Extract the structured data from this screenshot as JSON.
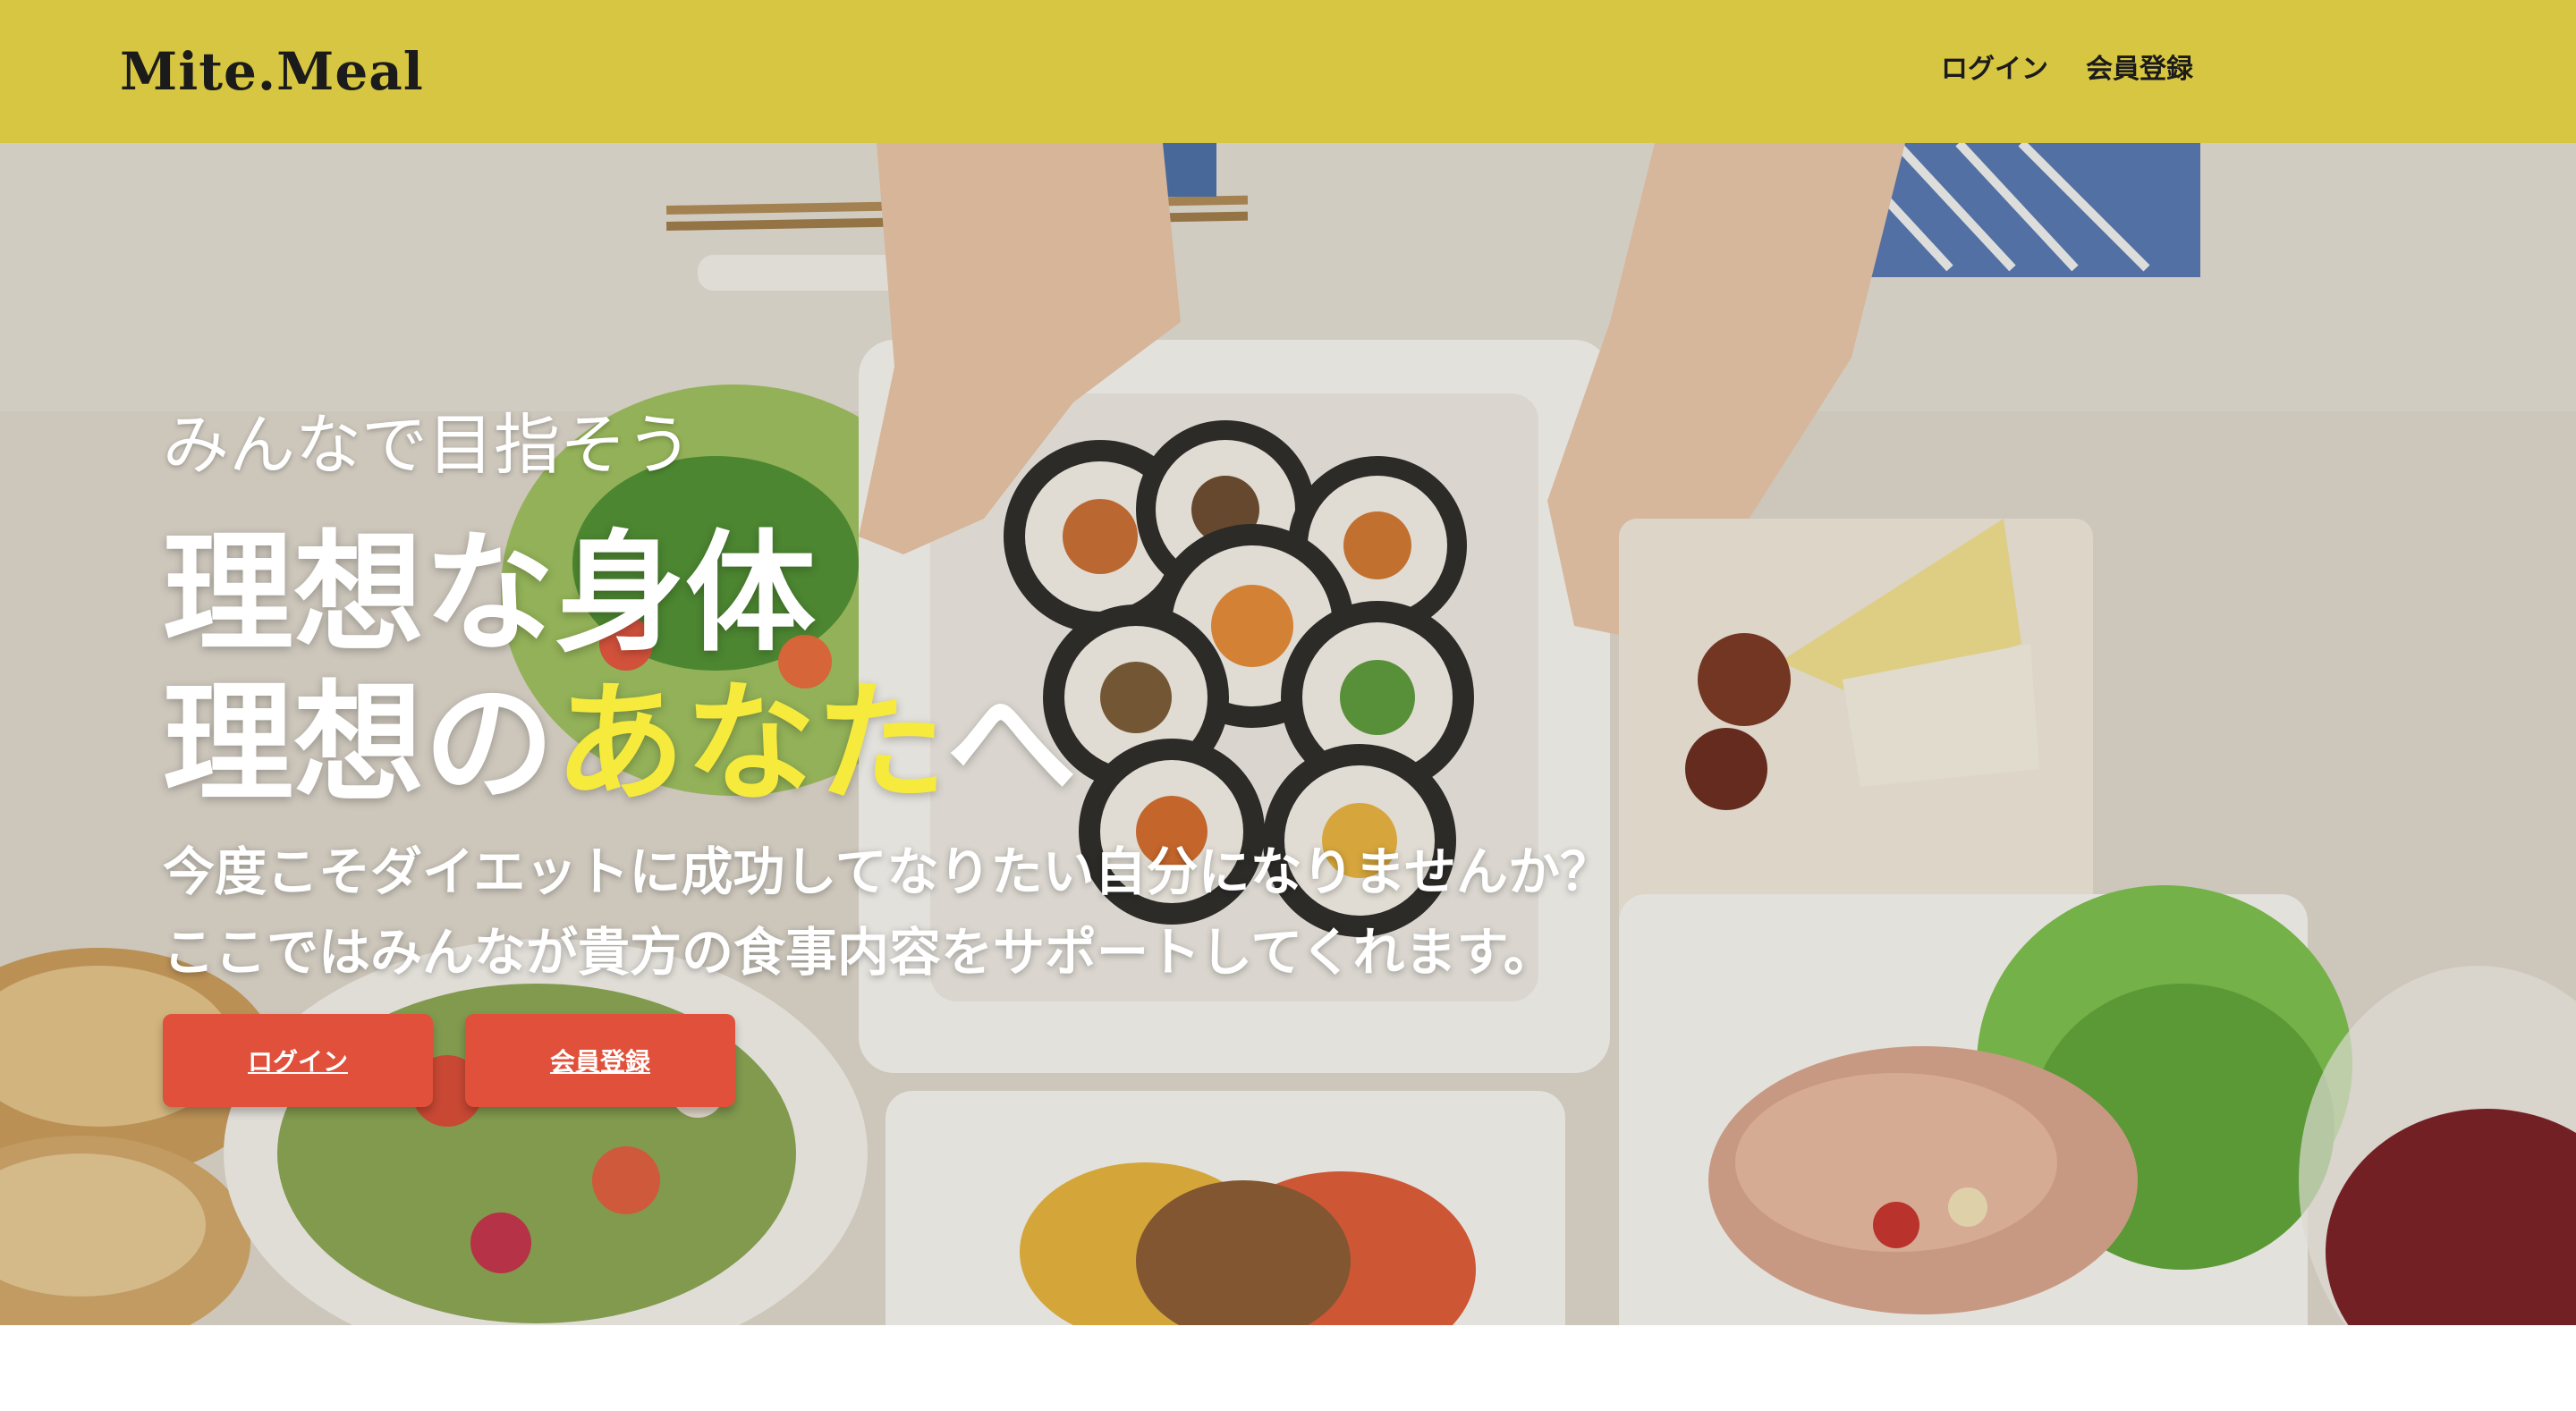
{
  "header": {
    "logo": "Mite.Meal",
    "nav": {
      "login": "ログイン",
      "signup": "会員登録"
    }
  },
  "hero": {
    "tagline": "みんなで目指そう",
    "headline": {
      "line1": "理想な身体",
      "line2_prefix": "理想の",
      "line2_highlight": "あなた",
      "line2_suffix": "へ"
    },
    "subtext": {
      "line1": "今度こそダイエットに成功してなりたい自分になりませんか？",
      "line2": "ここではみんなが貴方の食事内容をサポートしてくれます。"
    },
    "buttons": {
      "login": "ログイン",
      "signup": "会員登録"
    }
  },
  "colors": {
    "header_bg": "#d7c641",
    "highlight": "#f6ea3d",
    "button_bg": "#e0503a",
    "text_light": "#ffffff"
  }
}
